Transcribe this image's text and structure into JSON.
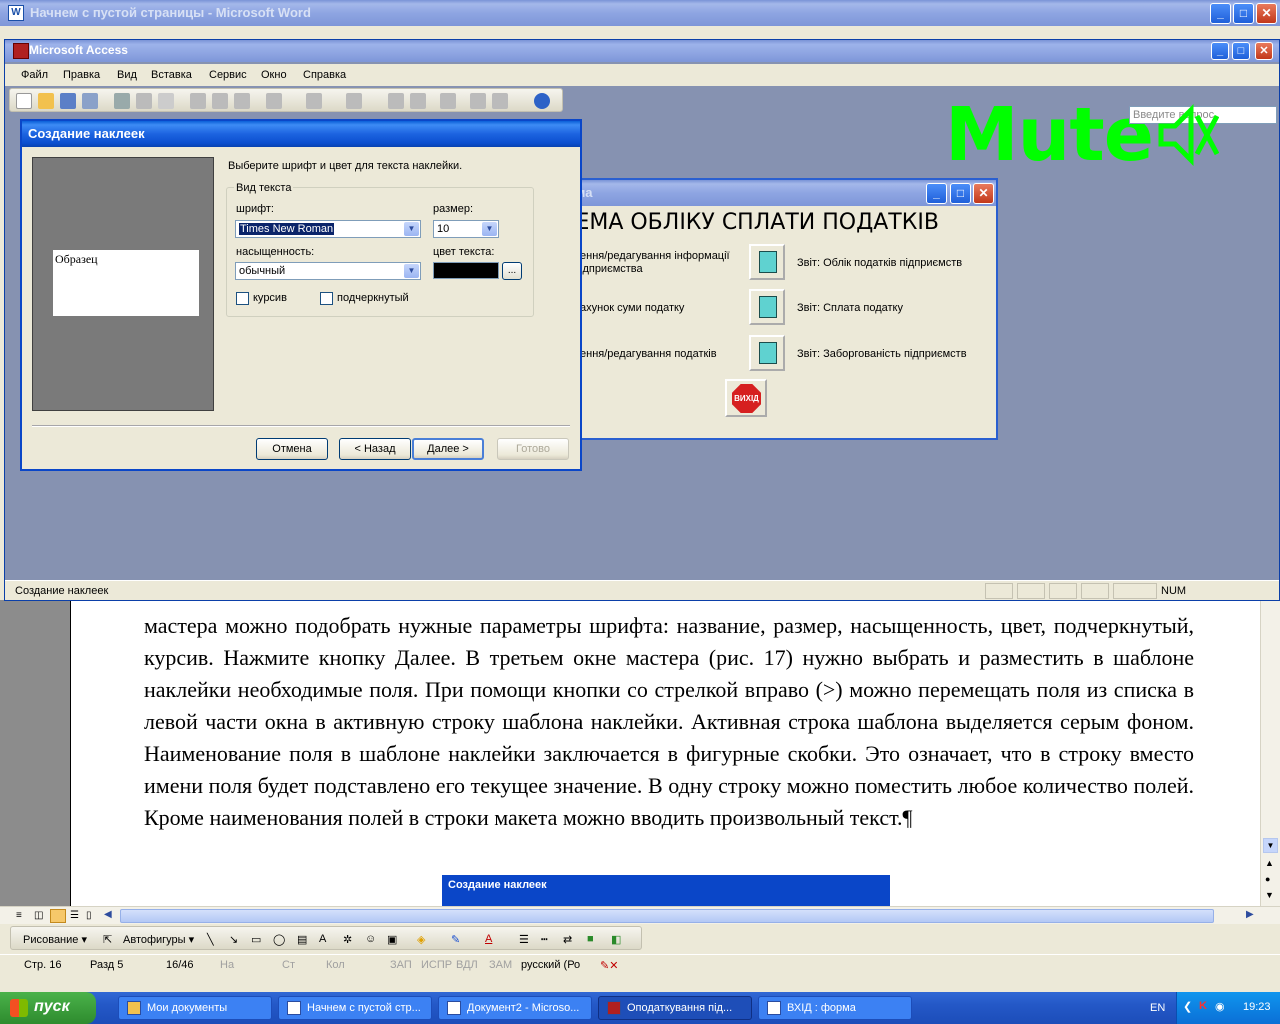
{
  "word": {
    "title": "Начнем с пустой страницы - Microsoft Word",
    "document_text": "мастера можно подобрать нужные параметры шрифта: название, размер, насыщенность, цвет, подчеркнутый, курсив. Нажмите кнопку Далее. В третьем окне мастера (рис. 17) нужно выбрать и разместить в шаблоне наклейки необходимые поля. При помощи кнопки со стрелкой вправо (>) можно перемещать поля из списка в левой части окна в активную строку шаблона наклейки. Активная строка шаблона выделяется серым фоном. Наименование поля в шаблоне наклейки заключается в фигурные скобки. Это означает, что в строку вместо имени поля будет подставлено его текущее значение. В одну строку можно поместить любое количество полей. Кроме наименования полей в строки макета можно вводить произвольный текст.¶",
    "embedded_dialog_title": "Создание наклеек",
    "drawing": {
      "draw_label": "Рисование ▾",
      "autoshapes_label": "Автофигуры ▾"
    },
    "status": {
      "page": "Стр. 16",
      "section": "Разд 5",
      "pages": "16/46",
      "at": "На",
      "line": "Ст",
      "col": "Кол",
      "rec": "ЗАП",
      "trk": "ИСПР",
      "ext": "ВДЛ",
      "ovr": "ЗАМ",
      "lang": "русский (Ро"
    }
  },
  "access": {
    "title": "Microsoft Access",
    "menu": [
      "Файл",
      "Правка",
      "Вид",
      "Вставка",
      "Сервис",
      "Окно",
      "Справка"
    ],
    "help_placeholder": "Введите вопрос",
    "overlay_text": "Mute",
    "status_text": "Создание наклеек",
    "status_num": "NUM"
  },
  "form": {
    "title": "рма",
    "heading": "ТЕМА ОБЛІКУ СПЛАТИ ПОДАТКІВ",
    "left_items": [
      "ення/редагування інформації\nідприємства",
      "ахунок суми податку",
      "ення/редагування податків"
    ],
    "right_items": [
      "Звіт: Облік податків підприємств",
      "Звіт: Сплата податку",
      "Звіт: Заборгованість підприємств"
    ],
    "exit_label": "ВИХІД"
  },
  "dialog": {
    "title": "Создание наклеек",
    "sample_text": "Образец",
    "instruction": "Выберите шрифт и цвет для текста наклейки.",
    "group_label": "Вид текста",
    "font_label": "шрифт:",
    "font_value": "Times New Roman",
    "size_label": "размер:",
    "size_value": "10",
    "weight_label": "насыщенность:",
    "weight_value": "обычный",
    "color_label": "цвет текста:",
    "italic_label": "курсив",
    "underline_label": "подчеркнутый",
    "buttons": {
      "cancel": "Отмена",
      "back": "< Назад",
      "next": "Далее >",
      "finish": "Готово"
    }
  },
  "taskbar": {
    "start": "пуск",
    "tasks": [
      "Мои документы",
      "Начнем с пустой стр...",
      "Документ2 - Microso...",
      "Оподаткування під...",
      "ВХІД : форма"
    ],
    "lang": "EN",
    "clock": "19:23"
  },
  "colors": {
    "xp_blue": "#0a46c8",
    "overlay_green": "#00ff00",
    "text_color_swatch": "#000000"
  }
}
